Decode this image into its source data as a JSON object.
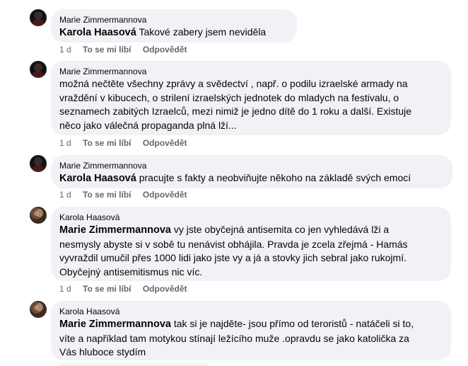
{
  "comments": [
    {
      "author": "Marie Zimmermannova",
      "avatar": "marie-avatar",
      "mention": "Karola Haasová",
      "text": "Takové zabery jsem neviděla",
      "time": "1 d",
      "like": "To se mi líbí",
      "reply": "Odpovědět"
    },
    {
      "author": "Marie Zimmermannova",
      "avatar": "marie-avatar",
      "mention": "",
      "text_lines": [
        "možná nečtěte všechny zprávy a svědectví , např. o podilu izraelské armady na",
        "vraždění v kibucech, o strilení izraelských jednotek do mladych na festivalu, o",
        "seznamech zabitých Izraelců, mezi nimiž je jedno dítě do 1 roku a další. Existuje",
        "něco jako válečná propaganda plná lží..."
      ],
      "time": "1 d",
      "like": "To se mi líbí",
      "reply": "Odpovědět"
    },
    {
      "author": "Marie Zimmermannova",
      "avatar": "marie-avatar",
      "mention": "Karola Haasová",
      "text": "pracujte s fakty a neobviňujte někoho na základě svých emocí",
      "time": "1 d",
      "like": "To se mi líbí",
      "reply": "Odpovědět"
    },
    {
      "author": "Karola Haasová",
      "avatar": "karola-avatar",
      "mention": "Marie Zimmermannova",
      "text_first": "vy jste obyčejná antisemita co jen vyhledává lži a",
      "text_lines": [
        "nesmysly abyste si v sobě tu nenávist obhájila. Pravda je zcela zřejmá - Hamás",
        "vyvraždil umučil přes 1000 lidi jako jste vy a já a stovky jich sebral jako rukojmí.",
        "Obyčejný antisemitismus nic víc."
      ],
      "time": "1 d",
      "like": "To se mi líbí",
      "reply": "Odpovědět"
    },
    {
      "author": "Karola Haasová",
      "avatar": "karola-avatar",
      "mention": "Marie Zimmermannova",
      "text_first": "tak si je najděte- jsou přímo od teroristů - natáčeli si to,",
      "text_lines": [
        "víte a například tam motykou stínají ležícího muže .opravdu se jako katolička za",
        "Vás hluboce stydím"
      ]
    }
  ]
}
